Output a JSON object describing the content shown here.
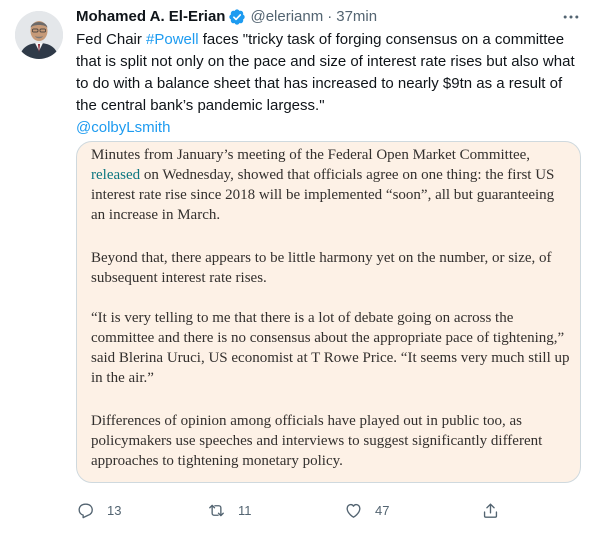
{
  "author": {
    "name": "Mohamed A. El-Erian",
    "handle": "@elerianm",
    "separator": "·",
    "time": "37min"
  },
  "tweet": {
    "line1_pre": "Fed Chair ",
    "hashtag": "#Powell",
    "line1_post": " faces \"tricky task of forging consensus on a committee",
    "line2": "that is split not only on the pace and size of interest rate rises but also what",
    "line3": "to do with a balance sheet that has increased to nearly $9tn as a result of",
    "line4": "the central bank’s pandemic largess.\"",
    "mention": "@colbyLsmith"
  },
  "quote": {
    "p1_l1": "Minutes from January’s meeting of the Federal Open Market Committee,",
    "p1_l2_link": "released",
    "p1_l2_rest": " on Wednesday, showed that officials agree on one thing: the first US",
    "p1_l3": "interest rate rise since 2018 will be implemented “soon”, all but guaranteeing",
    "p1_l4": "an increase in March.",
    "p2_l1": "Beyond that, there appears to be little harmony yet on the number, or size, of",
    "p2_l2": "subsequent interest rate rises.",
    "p3_l1": "“It is very telling to me that there is a lot of debate going on across the",
    "p3_l2": "committee and there is no consensus about the appropriate pace of tightening,”",
    "p3_l3": "said Blerina Uruci, US economist at T Rowe Price. “It seems very much still up",
    "p3_l4": "in the air.”",
    "p4_l1": "Differences of opinion among officials have played out in public too, as",
    "p4_l2": "policymakers use speeches and interviews to suggest significantly different",
    "p4_l3": "approaches to tightening monetary policy."
  },
  "actions": {
    "reply_count": "13",
    "retweet_count": "11",
    "like_count": "47"
  },
  "icons": {
    "verified": "verified-badge-icon",
    "more": "more-options-icon",
    "reply": "reply-icon",
    "retweet": "retweet-icon",
    "like": "heart-icon",
    "share": "share-icon"
  },
  "colors": {
    "accent": "#1d9bf0",
    "quote_background": "#fdf1e6",
    "quote_link": "#0d7680",
    "secondary_text": "#536471"
  }
}
